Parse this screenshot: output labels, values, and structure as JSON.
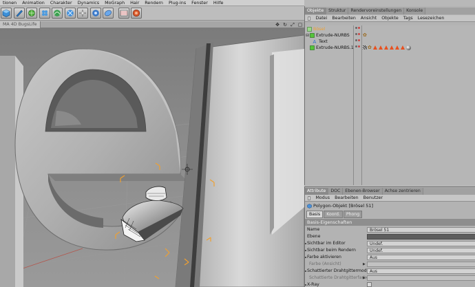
{
  "menubar": {
    "items": [
      "tionen",
      "Animation",
      "Charakter",
      "Dynamics",
      "MoGraph",
      "Hair",
      "Rendern",
      "Plug-ins",
      "Fenster",
      "Hilfe"
    ]
  },
  "toolbar": {
    "icons": [
      "cube-icon",
      "pen-icon",
      "subdivision-icon",
      "clone-icon",
      "spline-icon",
      "deformer-icon",
      "light-icon",
      "camera-icon",
      "scene-icon",
      "filmstrip-icon",
      "render-icon"
    ]
  },
  "viewport": {
    "tab_label": "MA 4D BugsLife"
  },
  "object_manager": {
    "tabs": [
      "Objekte",
      "Struktur",
      "Rendervoreinstellungen",
      "Konsole"
    ],
    "menu": [
      "Datei",
      "Bearbeiten",
      "Ansicht",
      "Objekte",
      "Tags",
      "Lesezeichen"
    ],
    "objects": [
      {
        "name": "Bösel",
        "selected": true
      },
      {
        "name": "Extrude-NURBS"
      },
      {
        "name": "Text"
      },
      {
        "name": "Extrude-NURBS.1"
      }
    ]
  },
  "attribute_manager": {
    "tabs": [
      "Attribute",
      "DOC",
      "Ebenen-Browser",
      "Achse zentrieren"
    ],
    "menu": [
      "Modus",
      "Bearbeiten",
      "Benutzer"
    ],
    "object_title": "Polygon-Objekt [Brösel 51]",
    "sub_tabs": [
      "Basis",
      "Koord.",
      "Phong"
    ],
    "section": "Basis-Eigenschaften",
    "rows": [
      {
        "label": "Name",
        "value": "Brösel 51"
      },
      {
        "label": "Ebene",
        "value": ""
      },
      {
        "label": "Sichtbar im Editor",
        "value": "Undef."
      },
      {
        "label": "Sichtbar beim Rendern",
        "value": "Undef."
      },
      {
        "label": "Farbe aktivieren",
        "value": "Aus"
      },
      {
        "label": "Farbe (Ansicht)",
        "value": ""
      },
      {
        "label": "Schattierter Drahtgittermodus",
        "value": "Aus"
      },
      {
        "label": "Schattierte Drahtgitterfarbe",
        "value": ""
      },
      {
        "label": "X-Ray",
        "value": ""
      }
    ]
  },
  "colors": {
    "accent": "#8a8a8a",
    "selection_orange": "#f0a030",
    "tag_red": "#e8501e",
    "object_green": "#55c43a"
  }
}
